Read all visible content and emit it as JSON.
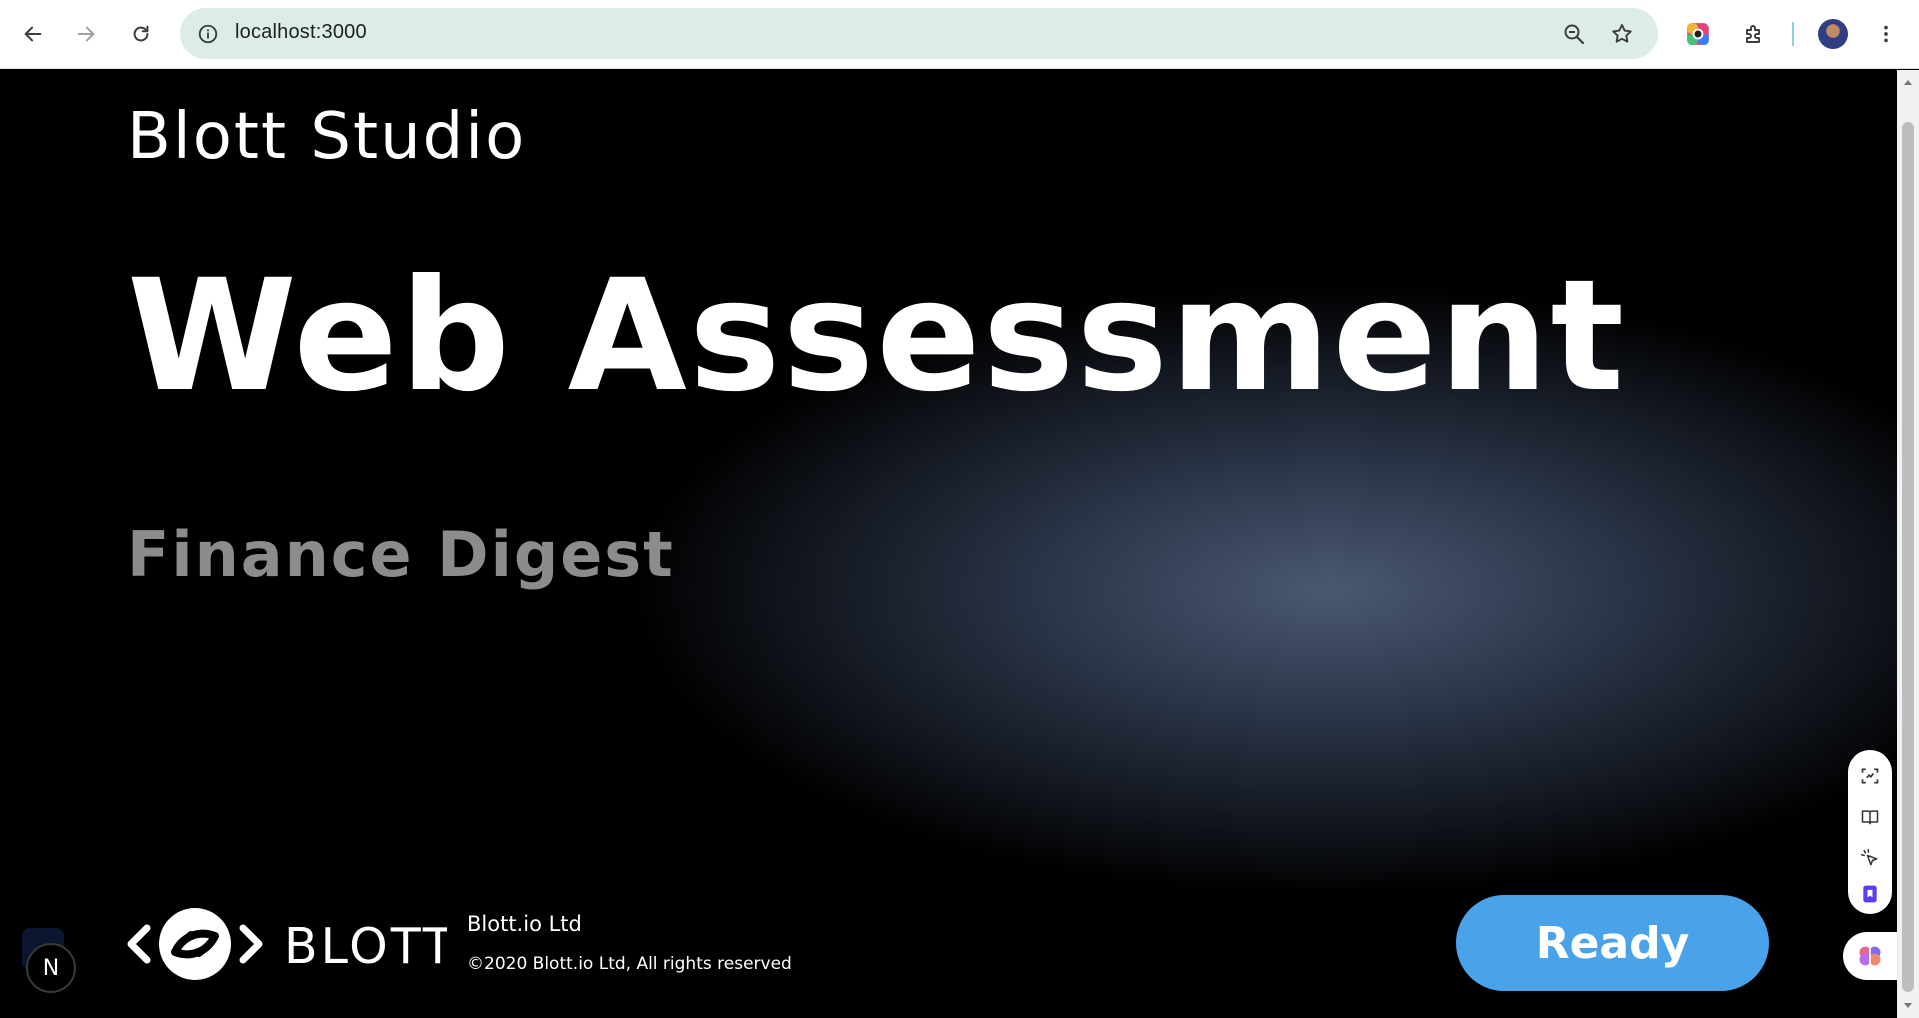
{
  "browser": {
    "url": "localhost:3000",
    "icons": {
      "back": "arrow-left-icon",
      "forward": "arrow-right-icon",
      "reload": "reload-icon",
      "site_info": "info-icon",
      "zoom": "zoom-out-icon",
      "bookmark": "star-icon",
      "extension_color": "color-extension-icon",
      "extensions": "puzzle-icon",
      "menu": "kebab-menu-icon"
    }
  },
  "page": {
    "brand": "Blott Studio",
    "title": "Web Assessment",
    "subtitle": "Finance Digest",
    "footer": {
      "logo_text": "BLOTT",
      "company": "Blott.io Ltd",
      "copyright": "©2020 Blott.io Ltd, All rights reserved"
    },
    "ready_button": "Ready",
    "dev_badge": "N"
  },
  "colors": {
    "accent_button": "#4aa3e8",
    "background": "#000000",
    "subtitle": "#8c8c8c"
  }
}
